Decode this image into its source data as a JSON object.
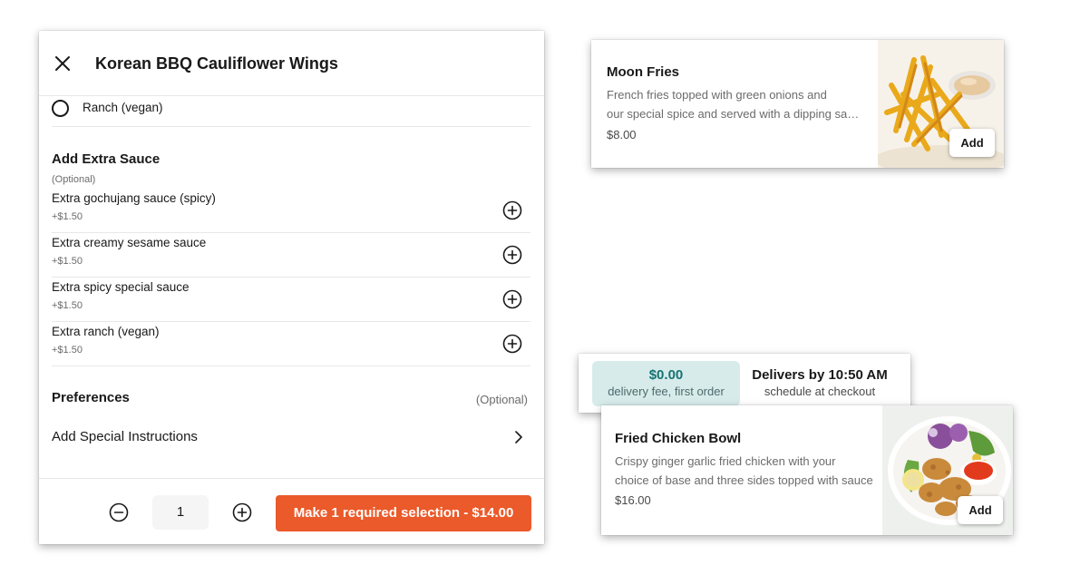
{
  "modal": {
    "title": "Korean BBQ Cauliflower Wings",
    "ranch_option": "Ranch (vegan)",
    "extra_sauce": {
      "title": "Add Extra Sauce",
      "optional": "(Optional)",
      "items": [
        {
          "name": "Extra gochujang sauce (spicy)",
          "price": "+$1.50"
        },
        {
          "name": "Extra creamy sesame sauce",
          "price": "+$1.50"
        },
        {
          "name": "Extra spicy special sauce",
          "price": "+$1.50"
        },
        {
          "name": "Extra ranch (vegan)",
          "price": "+$1.50"
        }
      ]
    },
    "preferences": {
      "title": "Preferences",
      "optional": "(Optional)",
      "instructions_label": "Add Special Instructions"
    },
    "footer": {
      "quantity": "1",
      "cta_label": "Make 1 required selection - $14.00"
    }
  },
  "moon_fries": {
    "name": "Moon Fries",
    "desc_line1": "French fries topped with green onions and",
    "desc_line2": "our special spice and served with a dipping sauce",
    "price": "$8.00",
    "add_label": "Add"
  },
  "delivery": {
    "fee_amount": "$0.00",
    "fee_label": "delivery fee, first order",
    "deliver_title": "Delivers by 10:50 AM",
    "deliver_sub": "schedule at checkout"
  },
  "fried_chicken": {
    "name": "Fried Chicken Bowl",
    "desc_line1": "Crispy ginger garlic fried chicken with your",
    "desc_line2": "choice of base and three sides topped with sauce",
    "price": "$16.00",
    "add_label": "Add"
  },
  "colors": {
    "accent": "#eb5a2a",
    "fee_bg": "#d7ebeb",
    "fee_text": "#177373"
  },
  "icons": [
    "close-icon",
    "radio-icon",
    "plus-circle-icon",
    "minus-circle-icon",
    "chevron-right-icon"
  ]
}
